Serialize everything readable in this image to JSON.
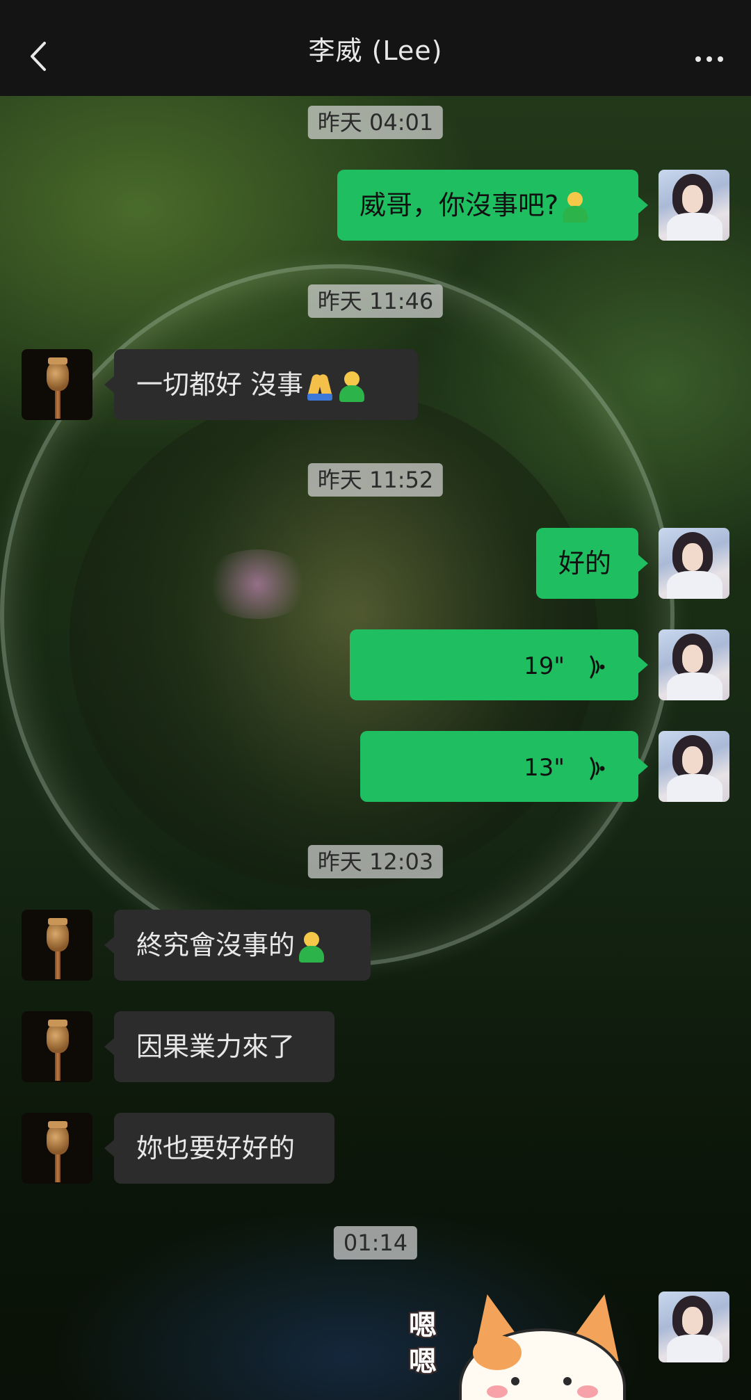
{
  "header": {
    "title": "李威 (Lee)"
  },
  "timestamps": {
    "t1": "昨天 04:01",
    "t2": "昨天 11:46",
    "t3": "昨天 11:52",
    "t4": "昨天 12:03",
    "t5": "01:14"
  },
  "messages": {
    "m1": "威哥，你沒事吧?",
    "m2": "一切都好 沒事",
    "m3": "好的",
    "v1": "19\"",
    "v2": "13\"",
    "m4": "終究會沒事的",
    "m5": "因果業力來了",
    "m6": "妳也要好好的"
  },
  "sticker": {
    "text": "嗯嗯"
  },
  "colors": {
    "outgoing_bubble": "#1fbf61",
    "incoming_bubble": "#2c2c2c",
    "nav_bar": "#141414"
  },
  "icons": {
    "back": "chevron-left-icon",
    "more": "more-dots-icon",
    "voice": "voice-wave-icon",
    "emoji_person": "person-gesturing-ok-emoji",
    "emoji_pray": "folded-hands-emoji"
  }
}
